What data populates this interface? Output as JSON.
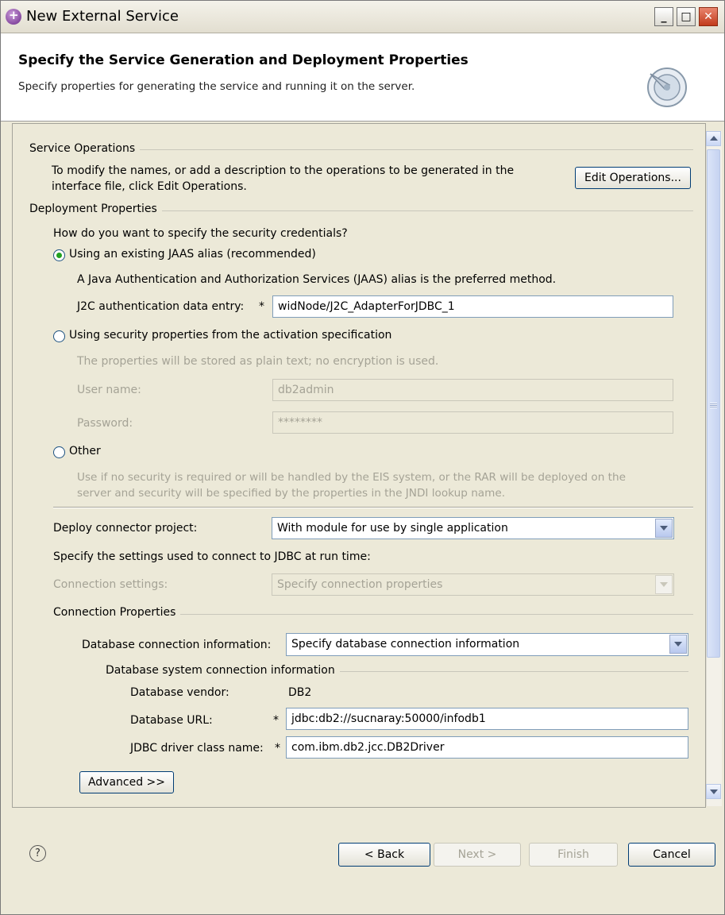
{
  "window": {
    "title": "New External Service"
  },
  "header": {
    "title": "Specify the Service Generation and Deployment Properties",
    "subtitle": "Specify properties for generating the service and running it on the server."
  },
  "service_operations": {
    "group_label": "Service Operations",
    "description_line1": "To modify the names, or add a description to the operations to be generated in the",
    "description_line2": "interface file, click Edit Operations.",
    "edit_button": "Edit Operations..."
  },
  "deployment": {
    "group_label": "Deployment Properties",
    "question": "How do you want to specify the security credentials?",
    "jaas": {
      "label": "Using an existing JAAS alias (recommended)",
      "selected": true,
      "note": "A Java Authentication and Authorization Services (JAAS) alias is the preferred method.",
      "entry_label": "J2C authentication data entry:",
      "entry_value": "widNode/J2C_AdapterForJDBC_1"
    },
    "activation_spec": {
      "label": "Using security properties from the activation specification",
      "selected": false,
      "note": "The properties will be stored as plain text; no encryption is used.",
      "user_label": "User name:",
      "user_value": "db2admin",
      "password_label": "Password:",
      "password_value": "********"
    },
    "other": {
      "label": "Other",
      "selected": false,
      "note_line1": "Use if no security is required or will be handled by the EIS system, or the RAR will be deployed on the",
      "note_line2": "server and security will be specified by the properties in the JNDI lookup name."
    },
    "deploy_label": "Deploy connector project:",
    "deploy_value": "With module for use by single application",
    "runtime_label": "Specify the settings used to connect to JDBC at run time:",
    "conn_settings_label": "Connection settings:",
    "conn_settings_value": "Specify connection properties"
  },
  "connection_properties": {
    "group_label": "Connection Properties",
    "db_conn_info_label": "Database connection information:",
    "db_conn_info_value": "Specify database connection information",
    "system_group_label": "Database system connection information",
    "vendor_label": "Database vendor:",
    "vendor_value": "DB2",
    "url_label": "Database URL:",
    "url_value": "jdbc:db2://sucnaray:50000/infodb1",
    "driver_label": "JDBC driver class name:",
    "driver_value": "com.ibm.db2.jcc.DB2Driver",
    "required_marker": "*",
    "advanced_button": "Advanced >>"
  },
  "footer": {
    "help_symbol": "?",
    "back": "< Back",
    "next": "Next >",
    "finish": "Finish",
    "cancel": "Cancel"
  }
}
